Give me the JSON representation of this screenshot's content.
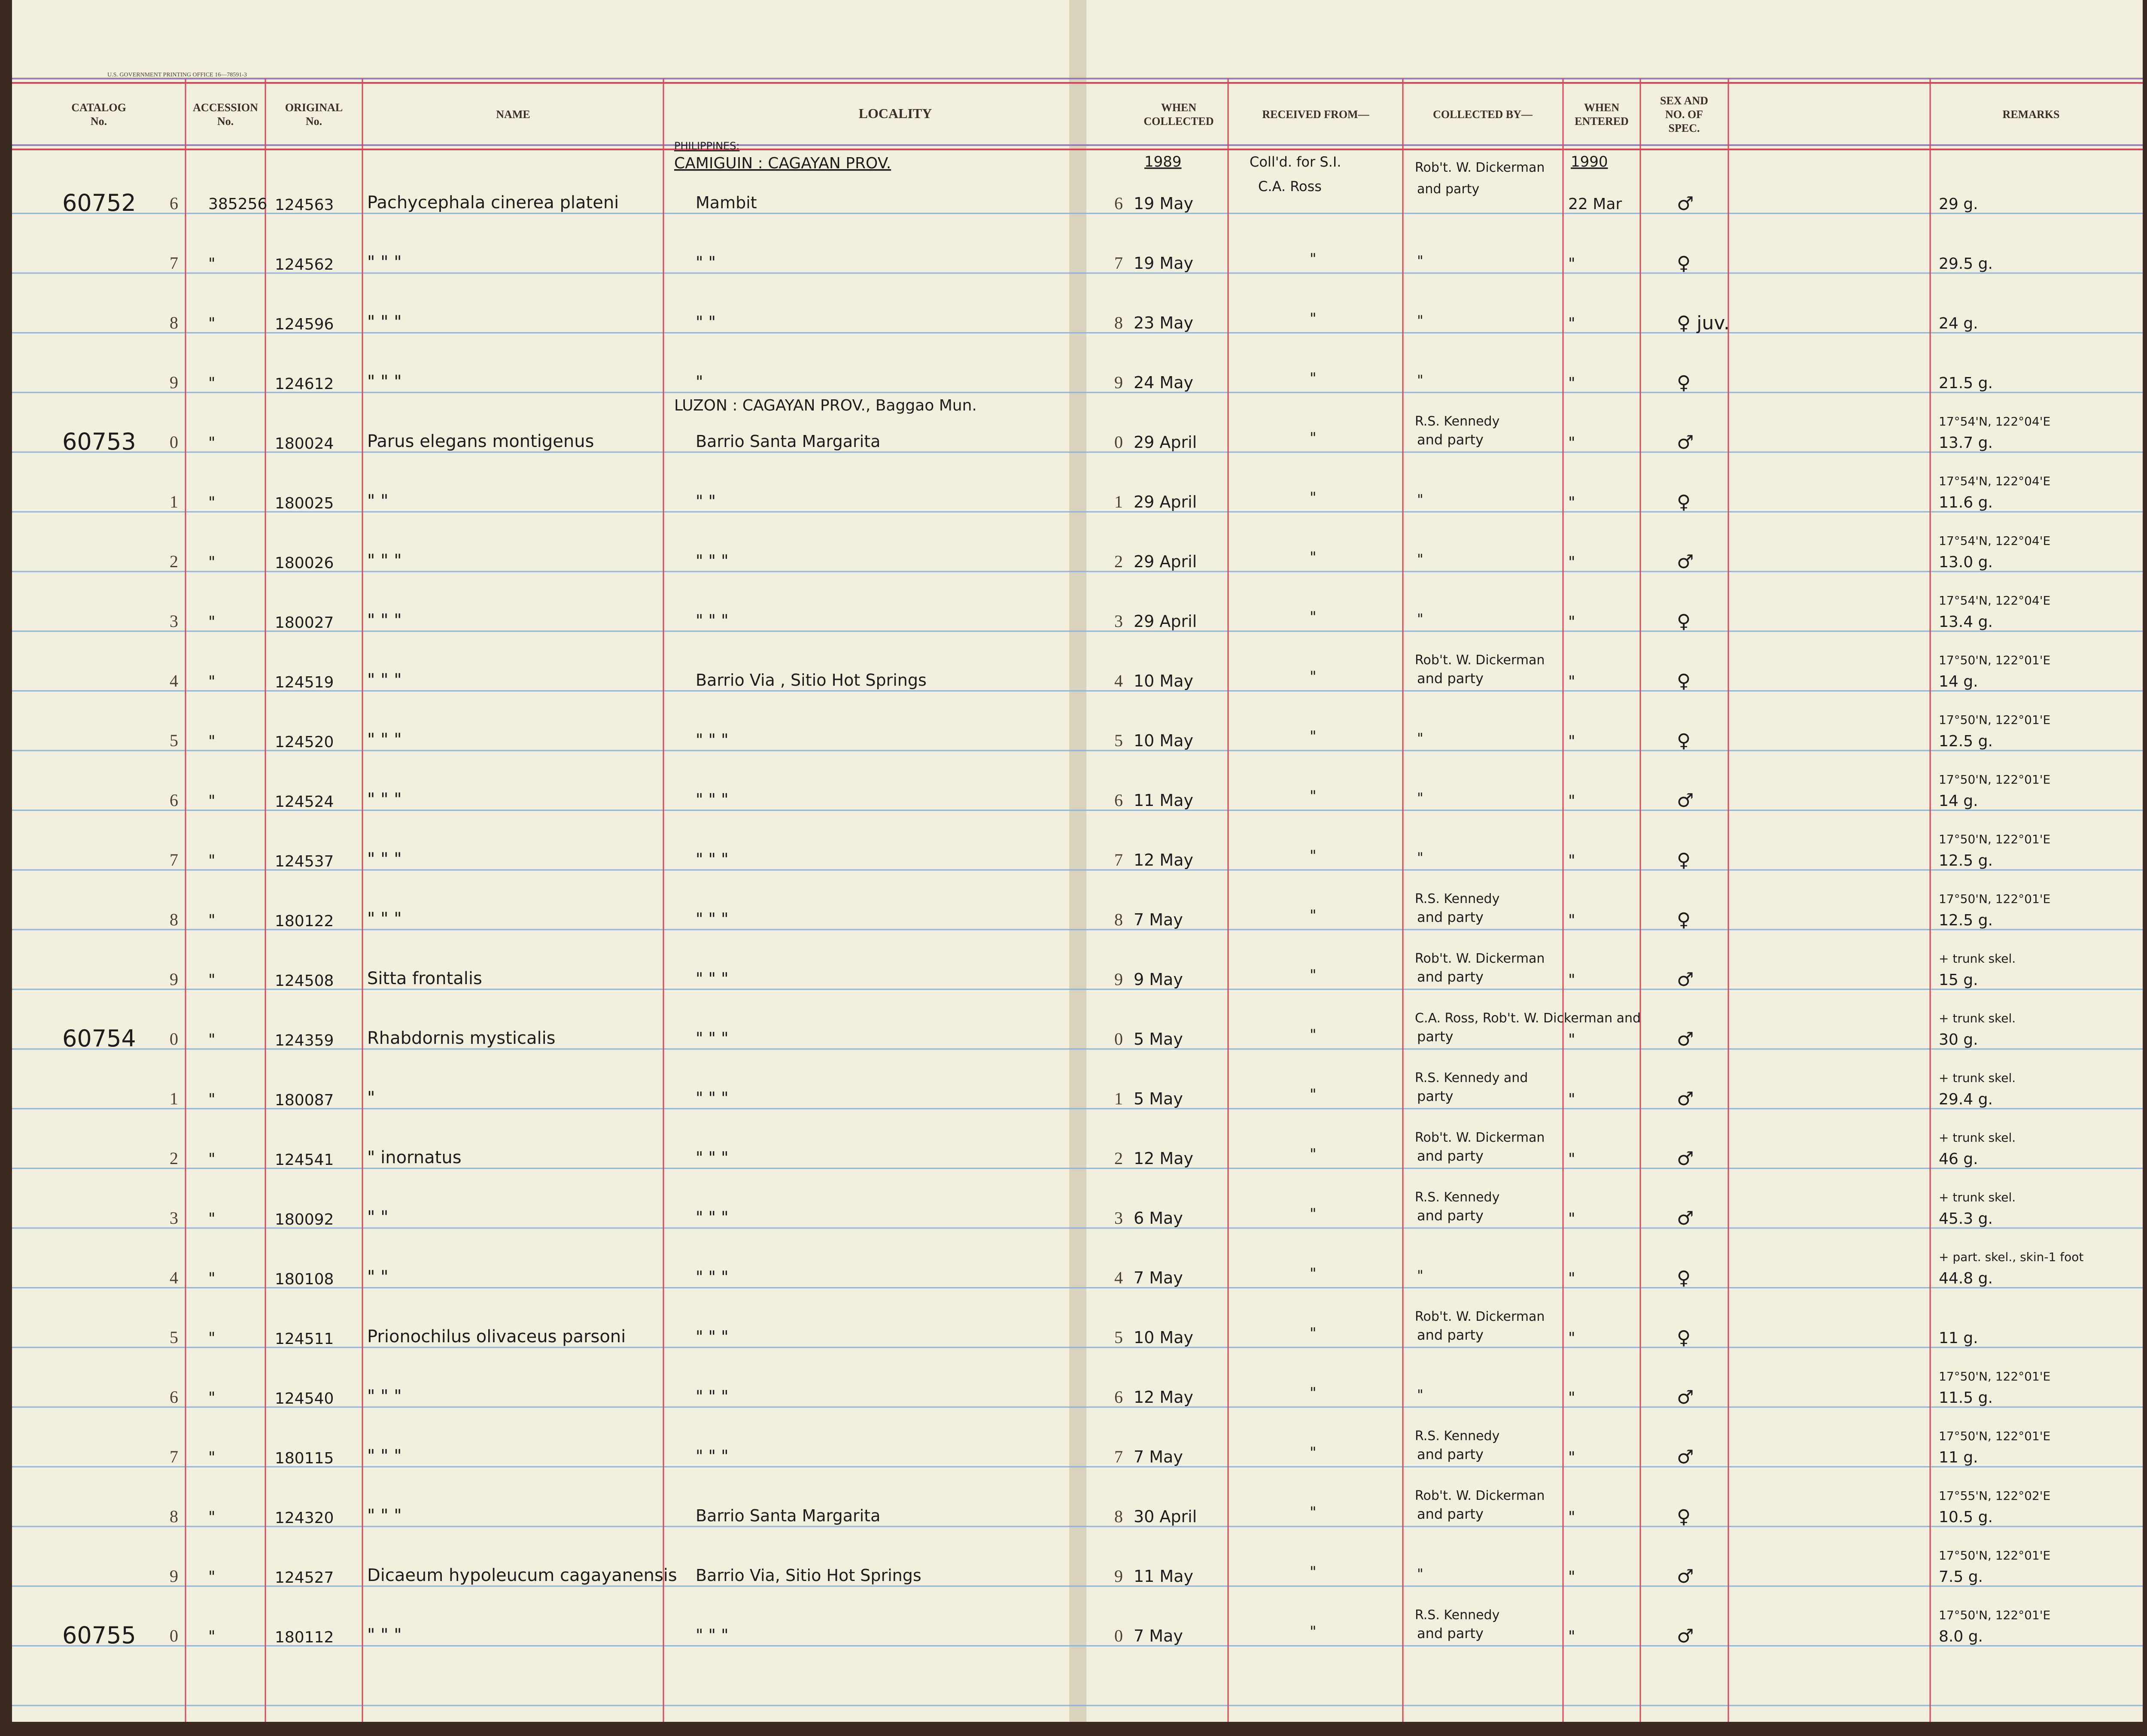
{
  "printer_line": "U.S. GOVERNMENT PRINTING OFFICE   16—78591-3",
  "headers": {
    "catalog": [
      "CATALOG",
      "No."
    ],
    "accession": [
      "ACCESSION",
      "No."
    ],
    "original": [
      "ORIGINAL",
      "No."
    ],
    "name": [
      "NAME"
    ],
    "locality": [
      "LOCALITY"
    ],
    "when_collected": [
      "WHEN",
      "COLLECTED"
    ],
    "received_from": [
      "RECEIVED FROM—"
    ],
    "collected_by": [
      "COLLECTED BY—"
    ],
    "when_entered": [
      "WHEN",
      "ENTERED"
    ],
    "sex": [
      "SEX AND",
      "NO. OF",
      "SPEC."
    ],
    "remarks": [
      "REMARKS"
    ]
  },
  "top_annotations": {
    "region": "PHILIPPINES:",
    "locality_header": "CAMIGUIN : CAGAYAN PROV.",
    "collected_year": "1989",
    "received_from": "Coll'd. for S.I.",
    "received_from_2": "C.A. Ross",
    "collected_by": "Rob't. W. Dickerman",
    "collected_by_2": "and party",
    "entered_year": "1990"
  },
  "rows": [
    {
      "catalog": "60752",
      "digit": "6",
      "accession": "385256",
      "original": "124563",
      "name": "Pachycephala cinerea plateni",
      "locality": "Mambit",
      "locality_above": "",
      "day": "19 May",
      "received": "",
      "collector": "",
      "collector_above": "",
      "entered": "22 Mar",
      "sex": "♂",
      "remarks": "29 g.",
      "remarks_above": ""
    },
    {
      "catalog": "",
      "digit": "7",
      "accession": "\"",
      "original": "124562",
      "name": "\"        \"        \"",
      "locality": "\"        \"",
      "locality_above": "",
      "day": "19 May",
      "received": "\"",
      "collector": "\"",
      "collector_above": "",
      "entered": "\"",
      "sex": "♀",
      "remarks": "29.5 g.",
      "remarks_above": ""
    },
    {
      "catalog": "",
      "digit": "8",
      "accession": "\"",
      "original": "124596",
      "name": "\"        \"        \"",
      "locality": "\"        \"",
      "locality_above": "",
      "day": "23 May",
      "received": "\"",
      "collector": "\"",
      "collector_above": "",
      "entered": "\"",
      "sex": "♀ juv.",
      "remarks": "24 g.",
      "remarks_above": ""
    },
    {
      "catalog": "",
      "digit": "9",
      "accession": "\"",
      "original": "124612",
      "name": "\"        \"        \"",
      "locality": "\"",
      "locality_above": "",
      "day": "24 May",
      "received": "\"",
      "collector": "\"",
      "collector_above": "",
      "entered": "\"",
      "sex": "♀",
      "remarks": "21.5 g.",
      "remarks_above": ""
    },
    {
      "catalog": "60753",
      "digit": "0",
      "accession": "\"",
      "original": "180024",
      "name": "Parus elegans montigenus",
      "locality": "Barrio  Santa  Margarita",
      "locality_above": "LUZON : CAGAYAN PROV., Baggao Mun.",
      "day": "29 April",
      "received": "\"",
      "collector": "and party",
      "collector_above": "R.S. Kennedy",
      "entered": "\"",
      "sex": "♂",
      "remarks": "13.7 g.",
      "remarks_above": "17°54'N, 122°04'E"
    },
    {
      "catalog": "",
      "digit": "1",
      "accession": "\"",
      "original": "180025",
      "name": "\"        \"",
      "locality": "\"        \"",
      "locality_above": "",
      "day": "29 April",
      "received": "\"",
      "collector": "\"",
      "collector_above": "",
      "entered": "\"",
      "sex": "♀",
      "remarks": "11.6 g.",
      "remarks_above": "17°54'N, 122°04'E"
    },
    {
      "catalog": "",
      "digit": "2",
      "accession": "\"",
      "original": "180026",
      "name": "\"        \"        \"",
      "locality": "\"        \"        \"",
      "locality_above": "",
      "day": "29 April",
      "received": "\"",
      "collector": "\"",
      "collector_above": "",
      "entered": "\"",
      "sex": "♂",
      "remarks": "13.0 g.",
      "remarks_above": "17°54'N, 122°04'E"
    },
    {
      "catalog": "",
      "digit": "3",
      "accession": "\"",
      "original": "180027",
      "name": "\"        \"        \"",
      "locality": "\"        \"        \"",
      "locality_above": "",
      "day": "29 April",
      "received": "\"",
      "collector": "\"",
      "collector_above": "",
      "entered": "\"",
      "sex": "♀",
      "remarks": "13.4 g.",
      "remarks_above": "17°54'N, 122°04'E"
    },
    {
      "catalog": "",
      "digit": "4",
      "accession": "\"",
      "original": "124519",
      "name": "\"        \"        \"",
      "locality": "Barrio Via ,  Sitio  Hot  Springs",
      "locality_above": "",
      "day": "10 May",
      "received": "\"",
      "collector": "and party",
      "collector_above": "Rob't. W. Dickerman",
      "entered": "\"",
      "sex": "♀",
      "remarks": "14 g.",
      "remarks_above": "17°50'N, 122°01'E"
    },
    {
      "catalog": "",
      "digit": "5",
      "accession": "\"",
      "original": "124520",
      "name": "\"        \"        \"",
      "locality": "\"        \"        \"",
      "locality_above": "",
      "day": "10 May",
      "received": "\"",
      "collector": "\"",
      "collector_above": "",
      "entered": "\"",
      "sex": "♀",
      "remarks": "12.5 g.",
      "remarks_above": "17°50'N, 122°01'E"
    },
    {
      "catalog": "",
      "digit": "6",
      "accession": "\"",
      "original": "124524",
      "name": "\"        \"        \"",
      "locality": "\"        \"        \"",
      "locality_above": "",
      "day": "11 May",
      "received": "\"",
      "collector": "\"",
      "collector_above": "",
      "entered": "\"",
      "sex": "♂",
      "remarks": "14 g.",
      "remarks_above": "17°50'N, 122°01'E"
    },
    {
      "catalog": "",
      "digit": "7",
      "accession": "\"",
      "original": "124537",
      "name": "\"        \"        \"",
      "locality": "\"        \"        \"",
      "locality_above": "",
      "day": "12 May",
      "received": "\"",
      "collector": "\"",
      "collector_above": "",
      "entered": "\"",
      "sex": "♀",
      "remarks": "12.5 g.",
      "remarks_above": "17°50'N, 122°01'E"
    },
    {
      "catalog": "",
      "digit": "8",
      "accession": "\"",
      "original": "180122",
      "name": "\"        \"        \"",
      "locality": "\"        \"        \"",
      "locality_above": "",
      "day": "7 May",
      "received": "\"",
      "collector": "and party",
      "collector_above": "R.S. Kennedy",
      "entered": "\"",
      "sex": "♀",
      "remarks": "12.5 g.",
      "remarks_above": "17°50'N, 122°01'E"
    },
    {
      "catalog": "",
      "digit": "9",
      "accession": "\"",
      "original": "124508",
      "name": "Sitta frontalis",
      "locality": "\"        \"        \"",
      "locality_above": "",
      "day": "9 May",
      "received": "\"",
      "collector": "and party",
      "collector_above": "Rob't. W. Dickerman",
      "entered": "\"",
      "sex": "♂",
      "remarks": "15 g.",
      "remarks_above": "+ trunk skel."
    },
    {
      "catalog": "60754",
      "digit": "0",
      "accession": "\"",
      "original": "124359",
      "name": "Rhabdornis mysticalis",
      "locality": "\"        \"        \"",
      "locality_above": "",
      "day": "5 May",
      "received": "\"",
      "collector": "party",
      "collector_above": "C.A. Ross, Rob't. W. Dickerman and",
      "entered": "\"",
      "sex": "♂",
      "remarks": "30 g.",
      "remarks_above": "+ trunk skel."
    },
    {
      "catalog": "",
      "digit": "1",
      "accession": "\"",
      "original": "180087",
      "name": "\"",
      "locality": "\"        \"        \"",
      "locality_above": "",
      "day": "5 May",
      "received": "\"",
      "collector": "party",
      "collector_above": "R.S. Kennedy and",
      "entered": "\"",
      "sex": "♂",
      "remarks": "29.4 g.",
      "remarks_above": "+ trunk skel."
    },
    {
      "catalog": "",
      "digit": "2",
      "accession": "\"",
      "original": "124541",
      "name": "\"        inornatus",
      "locality": "\"        \"        \"",
      "locality_above": "",
      "day": "12 May",
      "received": "\"",
      "collector": "and party",
      "collector_above": "Rob't. W. Dickerman",
      "entered": "\"",
      "sex": "♂",
      "remarks": "46 g.",
      "remarks_above": "+ trunk skel."
    },
    {
      "catalog": "",
      "digit": "3",
      "accession": "\"",
      "original": "180092",
      "name": "\"        \"",
      "locality": "\"        \"        \"",
      "locality_above": "",
      "day": "6 May",
      "received": "\"",
      "collector": "and party",
      "collector_above": "R.S. Kennedy",
      "entered": "\"",
      "sex": "♂",
      "remarks": "45.3 g.",
      "remarks_above": "+ trunk skel."
    },
    {
      "catalog": "",
      "digit": "4",
      "accession": "\"",
      "original": "180108",
      "name": "\"        \"",
      "locality": "\"        \"        \"",
      "locality_above": "",
      "day": "7 May",
      "received": "\"",
      "collector": "\"",
      "collector_above": "",
      "entered": "\"",
      "sex": "♀",
      "remarks": "44.8 g.",
      "remarks_above": "+ part. skel., skin-1 foot"
    },
    {
      "catalog": "",
      "digit": "5",
      "accession": "\"",
      "original": "124511",
      "name": "Prionochilus olivaceus parsoni",
      "locality": "\"        \"        \"",
      "locality_above": "",
      "day": "10 May",
      "received": "\"",
      "collector": "and party",
      "collector_above": "Rob't. W. Dickerman",
      "entered": "\"",
      "sex": "♀",
      "remarks": "11 g.",
      "remarks_above": ""
    },
    {
      "catalog": "",
      "digit": "6",
      "accession": "\"",
      "original": "124540",
      "name": "\"        \"        \"",
      "locality": "\"        \"        \"",
      "locality_above": "",
      "day": "12 May",
      "received": "\"",
      "collector": "\"",
      "collector_above": "",
      "entered": "\"",
      "sex": "♂",
      "remarks": "11.5 g.",
      "remarks_above": "17°50'N, 122°01'E"
    },
    {
      "catalog": "",
      "digit": "7",
      "accession": "\"",
      "original": "180115",
      "name": "\"        \"        \"",
      "locality": "\"        \"        \"",
      "locality_above": "",
      "day": "7 May",
      "received": "\"",
      "collector": "and party",
      "collector_above": "R.S. Kennedy",
      "entered": "\"",
      "sex": "♂",
      "remarks": "11 g.",
      "remarks_above": "17°50'N, 122°01'E"
    },
    {
      "catalog": "",
      "digit": "8",
      "accession": "\"",
      "original": "124320",
      "name": "\"        \"        \"",
      "locality": "Barrio  Santa  Margarita",
      "locality_above": "",
      "day": "30 April",
      "received": "\"",
      "collector": "and party",
      "collector_above": "Rob't. W. Dickerman",
      "entered": "\"",
      "sex": "♀",
      "remarks": "10.5 g.",
      "remarks_above": "17°55'N, 122°02'E"
    },
    {
      "catalog": "",
      "digit": "9",
      "accession": "\"",
      "original": "124527",
      "name": "Dicaeum hypoleucum cagayanensis",
      "locality": "Barrio  Via,  Sitio  Hot  Springs",
      "locality_above": "",
      "day": "11 May",
      "received": "\"",
      "collector": "\"",
      "collector_above": "",
      "entered": "\"",
      "sex": "♂",
      "remarks": "7.5 g.",
      "remarks_above": "17°50'N, 122°01'E"
    },
    {
      "catalog": "60755",
      "digit": "0",
      "accession": "\"",
      "original": "180112",
      "name": "\"        \"        \"",
      "locality": "\"        \"        \"",
      "locality_above": "",
      "day": "7 May",
      "received": "\"",
      "collector": "and party",
      "collector_above": "R.S. Kennedy",
      "entered": "\"",
      "sex": "♂",
      "remarks": "8.0 g.",
      "remarks_above": "17°50'N, 122°01'E"
    }
  ],
  "colors": {
    "paper": "#f3efdf",
    "gutter": "#d9d2bd",
    "rule_blue": "#8fb6d9",
    "rule_red": "#d4485a",
    "ink": "#1c1c1c",
    "header_ink": "#3a2f28",
    "binding": "#3a2a22"
  }
}
